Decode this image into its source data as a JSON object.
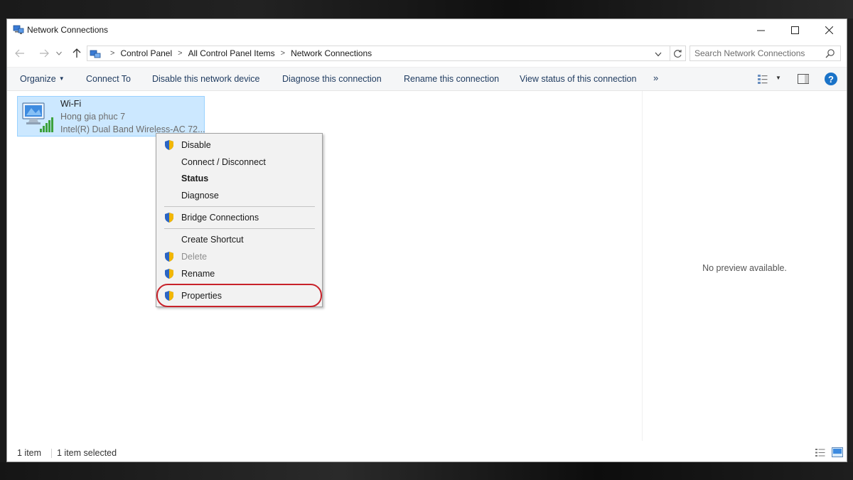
{
  "window": {
    "title": "Network Connections"
  },
  "address": {
    "crumbs": [
      "Control Panel",
      "All Control Panel Items",
      "Network Connections"
    ],
    "search_placeholder": "Search Network Connections"
  },
  "toolbar": {
    "organize": "Organize",
    "connect_to": "Connect To",
    "disable": "Disable this network device",
    "diagnose": "Diagnose this connection",
    "rename": "Rename this connection",
    "view_status": "View status of this connection",
    "more": "»",
    "help": "?"
  },
  "connection": {
    "name": "Wi-Fi",
    "ssid": "Hong gia phuc 7",
    "adapter": "Intel(R) Dual Band Wireless-AC 72..."
  },
  "context_menu": {
    "items": [
      {
        "label": "Disable",
        "shield": true
      },
      {
        "label": "Connect / Disconnect",
        "shield": false
      },
      {
        "label": "Status",
        "shield": false,
        "bold": true
      },
      {
        "label": "Diagnose",
        "shield": false
      },
      {
        "label": "Bridge Connections",
        "shield": true
      },
      {
        "label": "Create Shortcut",
        "shield": false
      },
      {
        "label": "Delete",
        "shield": true,
        "disabled": true
      },
      {
        "label": "Rename",
        "shield": true
      },
      {
        "label": "Properties",
        "shield": true,
        "highlighted": true
      }
    ]
  },
  "preview": {
    "text": "No preview available."
  },
  "status": {
    "item_count": "1 item",
    "selected": "1 item selected"
  },
  "colors": {
    "selection_bg": "#cce8ff",
    "highlight_ring": "#c8222a",
    "help_blue": "#1a73c8"
  }
}
